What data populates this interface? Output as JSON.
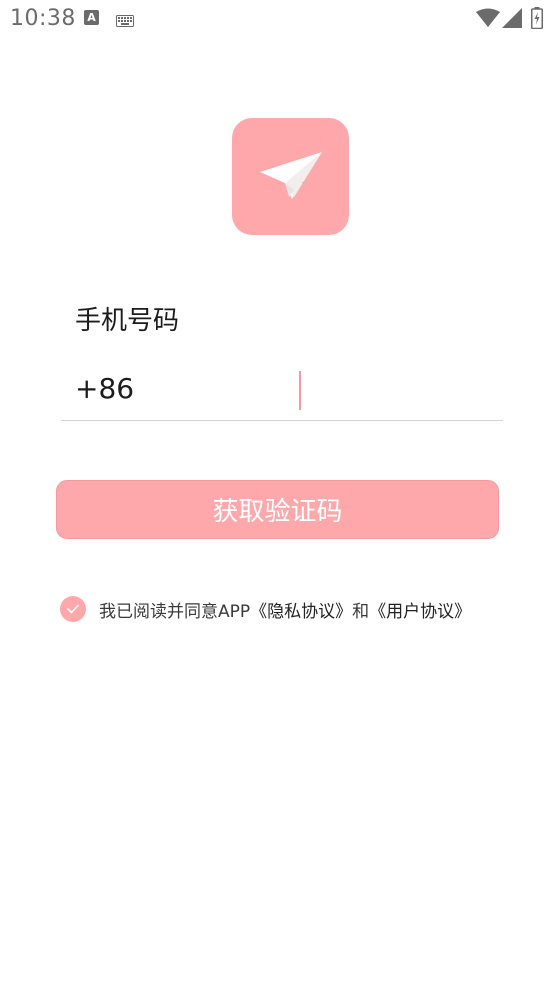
{
  "status_bar": {
    "time": "10:38",
    "notification_icon_letter": "A",
    "icons": [
      "a-notification-icon",
      "keyboard-icon",
      "wifi-icon",
      "signal-icon",
      "battery-charging-icon"
    ]
  },
  "logo": {
    "icon": "paper-plane-icon",
    "color": "#ffa8ac"
  },
  "form": {
    "phone_label": "手机号码",
    "country_code": "+86",
    "phone_value": "",
    "phone_placeholder": ""
  },
  "button": {
    "label": "获取验证码",
    "color": "#ffa8ac"
  },
  "agreement": {
    "checked": true,
    "prefix": "我已阅读并同意APP",
    "privacy_link": "《隐私协议》",
    "conjunction": "和",
    "user_link": "《用户协议》"
  }
}
